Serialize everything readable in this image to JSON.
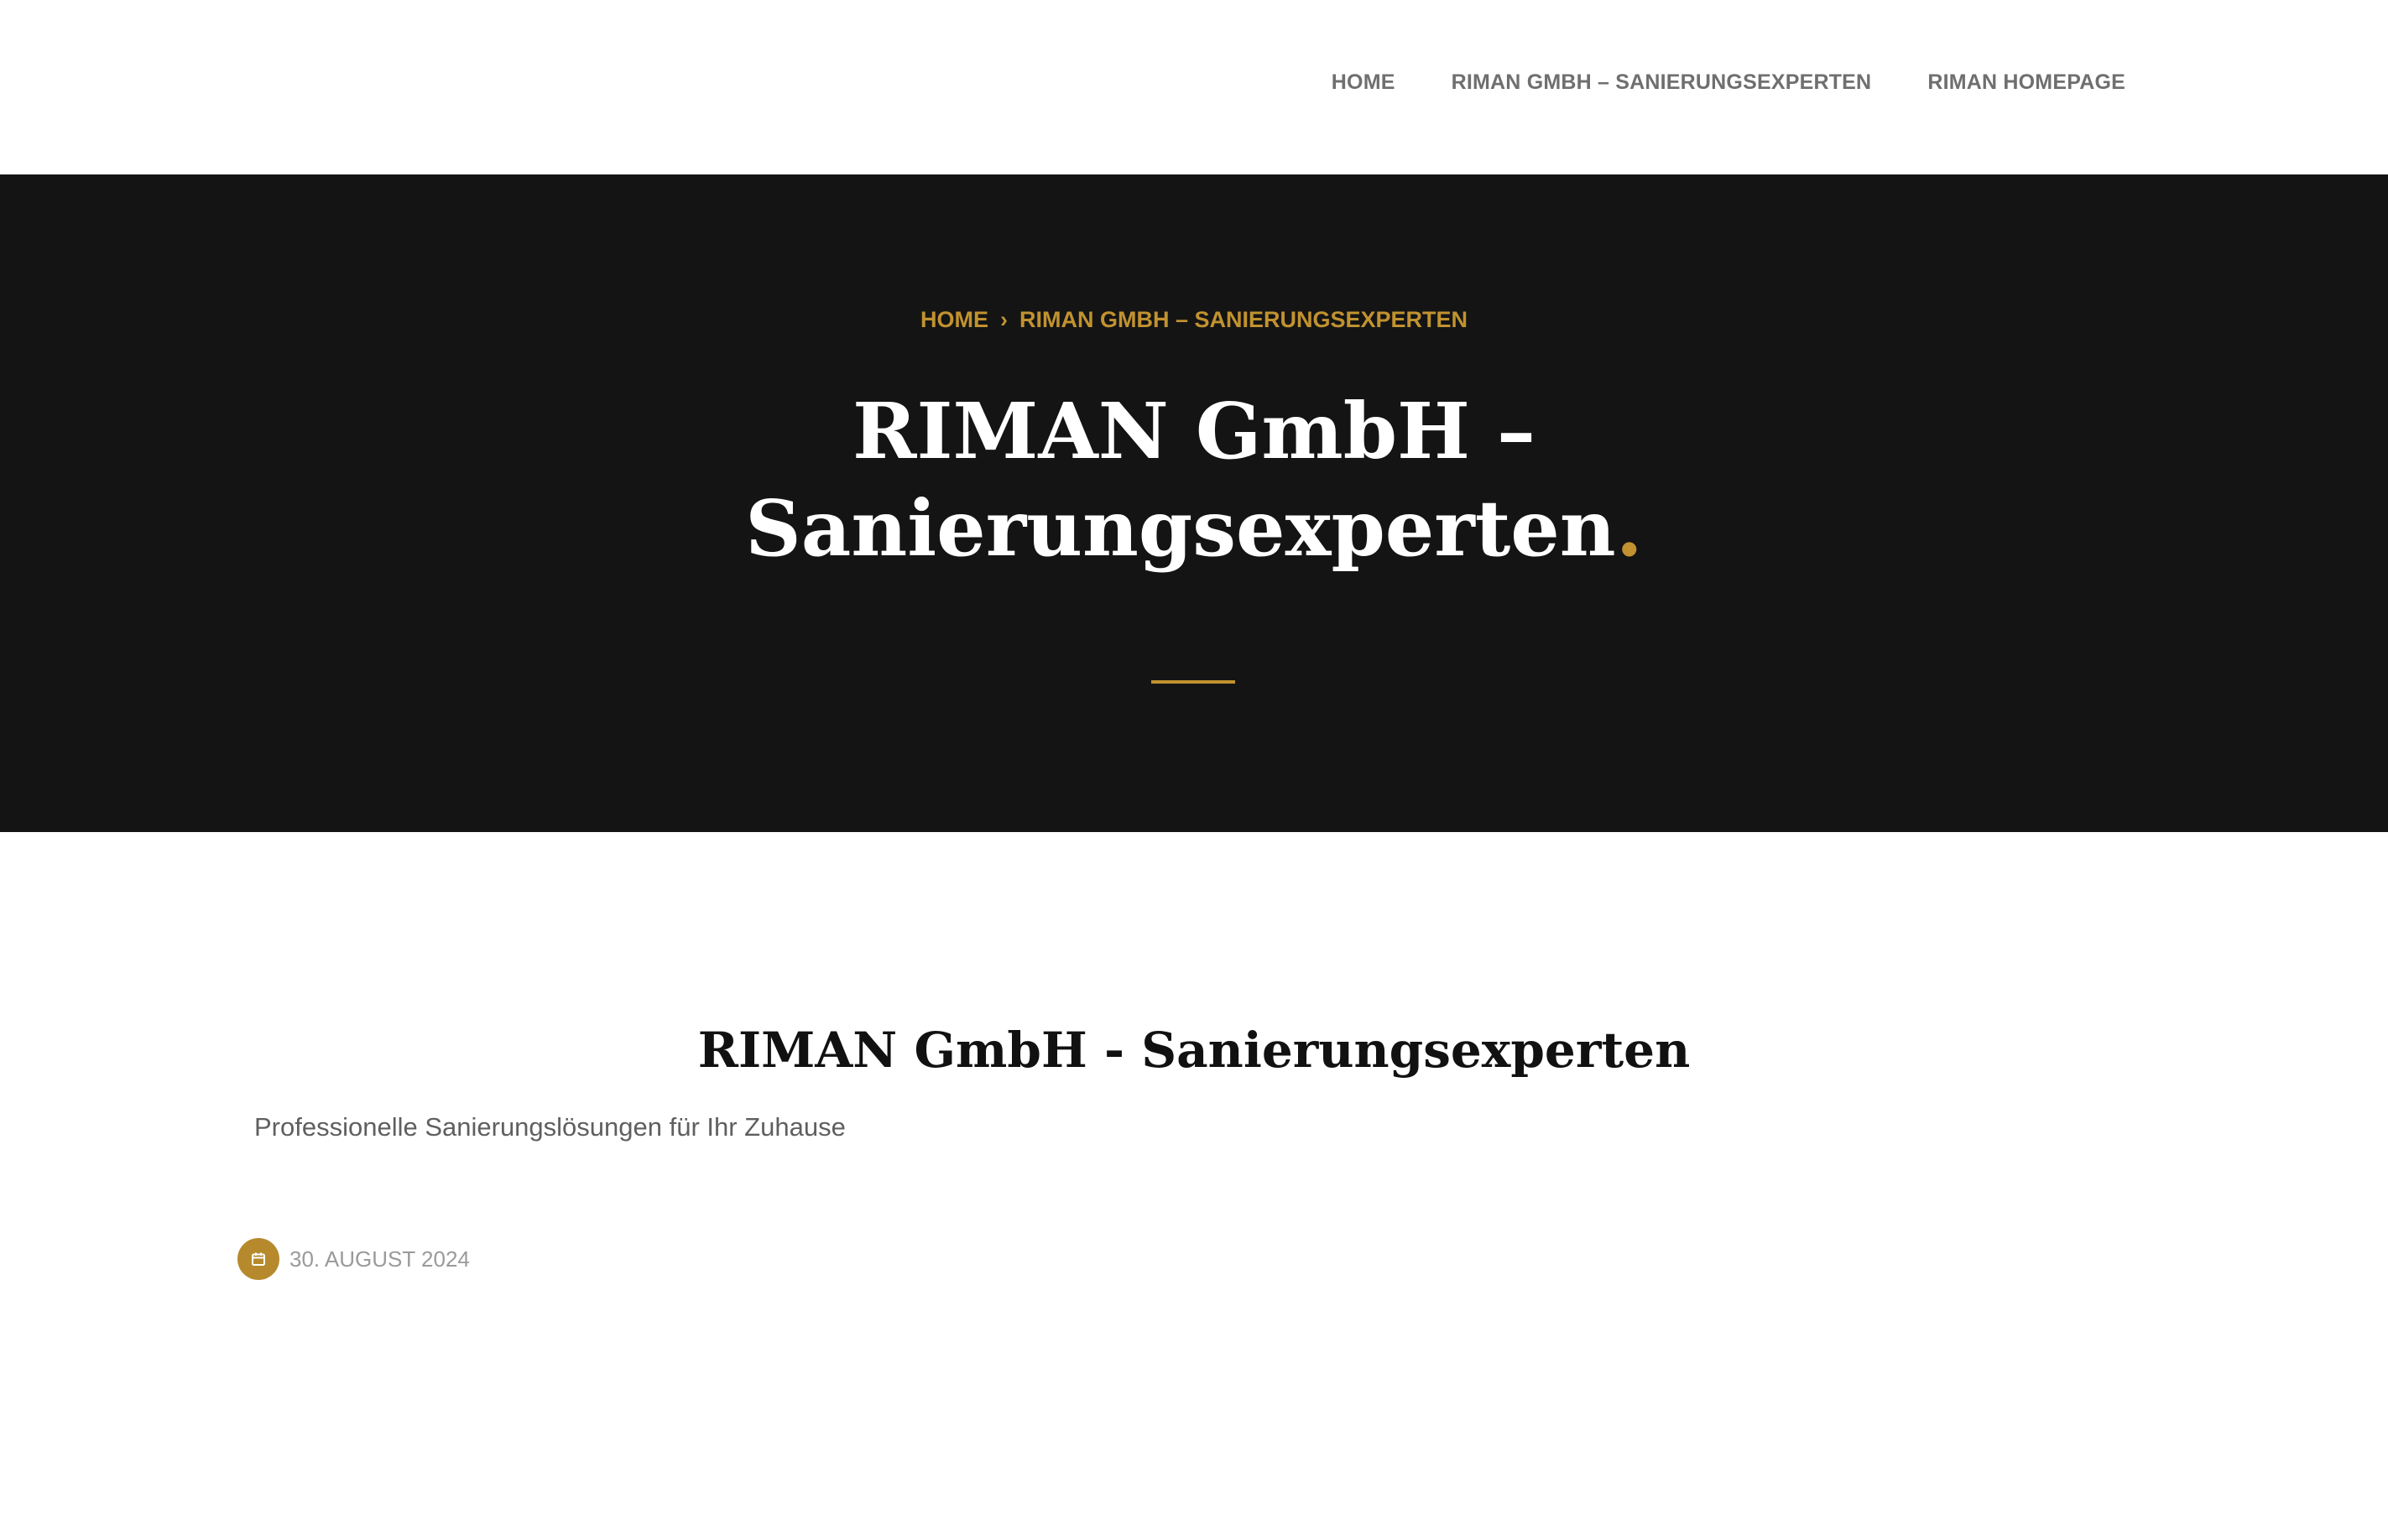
{
  "nav": {
    "items": [
      {
        "label": "HOME"
      },
      {
        "label": "RIMAN GMBH – SANIERUNGSEXPERTEN"
      },
      {
        "label": "RIMAN HOMEPAGE"
      }
    ]
  },
  "hero": {
    "breadcrumb": {
      "home": "HOME",
      "separator": "›",
      "current": "RIMAN GMBH – SANIERUNGSEXPERTEN"
    },
    "title_line1": "RIMAN GmbH –",
    "title_line2": "Sanierungsexperten",
    "title_dot": "."
  },
  "content": {
    "heading": "RIMAN GmbH - Sanierungsexperten",
    "subtitle": "Professionelle Sanierungslösungen für Ihr Zuhause",
    "date": "30. AUGUST 2024"
  },
  "colors": {
    "accent": "#c1922f",
    "hero_bg": "#141414",
    "nav_text": "#6f6f6f"
  },
  "icons": {
    "date": "calendar-icon"
  }
}
